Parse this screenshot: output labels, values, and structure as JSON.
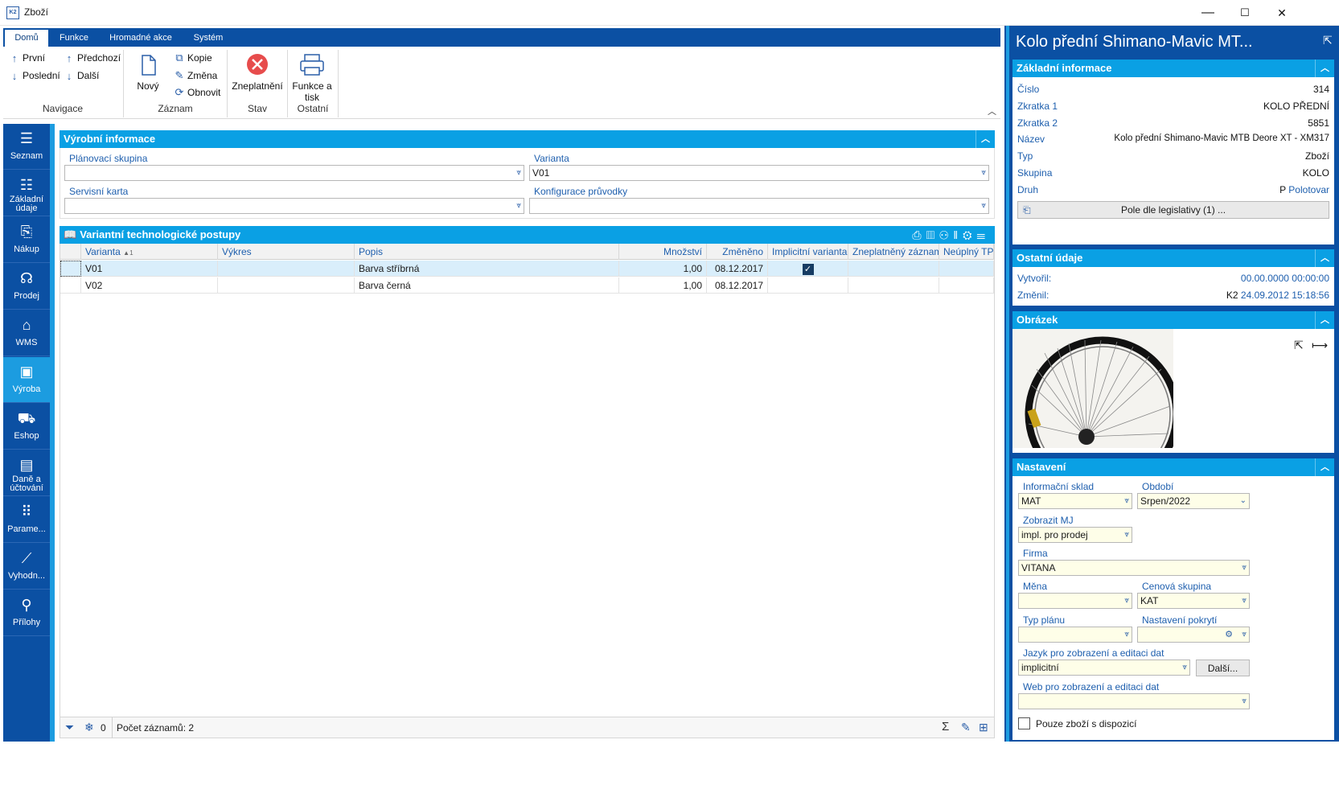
{
  "window": {
    "logo": "K2",
    "title": "Zboží",
    "minimize": "—",
    "maximize": "☐",
    "close": "✕"
  },
  "ribbon": {
    "tabs": [
      "Domů",
      "Funkce",
      "Hromadné akce",
      "Systém"
    ],
    "navigace": {
      "first": "První",
      "last": "Poslední",
      "prev": "Předchozí",
      "next": "Další",
      "label": "Navigace"
    },
    "zaznam": {
      "new": "Nový",
      "copy": "Kopie",
      "change": "Změna",
      "refresh": "Obnovit",
      "label": "Záznam"
    },
    "stav": {
      "invalidate": "Zneplatnění",
      "label": "Stav"
    },
    "ostatni": {
      "functions_line1": "Funkce a",
      "functions_line2": "tisk",
      "label": "Ostatní"
    }
  },
  "nav": [
    {
      "label": "Seznam",
      "icon": "list-icon"
    },
    {
      "label": "Základní údaje",
      "icon": "details-icon"
    },
    {
      "label": "Nákup",
      "icon": "purchase-icon"
    },
    {
      "label": "Prodej",
      "icon": "sale-icon"
    },
    {
      "label": "WMS",
      "icon": "warehouse-icon"
    },
    {
      "label": "Výroba",
      "icon": "production-icon"
    },
    {
      "label": "Eshop",
      "icon": "cart-icon"
    },
    {
      "label": "Daně a účtování",
      "icon": "tax-icon"
    },
    {
      "label": "Parame...",
      "icon": "grid-icon"
    },
    {
      "label": "Vyhodn...",
      "icon": "analytics-icon"
    },
    {
      "label": "Přílohy",
      "icon": "paperclip-icon"
    }
  ],
  "production_info": {
    "title": "Výrobní informace",
    "planning_group_label": "Plánovací skupina",
    "planning_group_value": "",
    "variant_label": "Varianta",
    "variant_value": "V01",
    "service_card_label": "Servisní karta",
    "service_card_value": "",
    "config_label": "Konfigurace průvodky",
    "config_value": ""
  },
  "variants_grid": {
    "title": "Variantní technologické postupy",
    "columns": [
      "Varianta",
      "Výkres",
      "Popis",
      "Množství",
      "Změněno",
      "Implicitní varianta",
      "Zneplatněný záznam",
      "Neúplný TP"
    ],
    "sort_indicator": "▲1",
    "rows": [
      {
        "varianta": "V01",
        "vykres": "",
        "popis": "Barva stříbrná",
        "mnozstvi": "1,00",
        "zmeneno": "08.12.2017",
        "implicitni": true
      },
      {
        "varianta": "V02",
        "vykres": "",
        "popis": "Barva černá",
        "mnozstvi": "1,00",
        "zmeneno": "08.12.2017",
        "implicitni": false
      }
    ],
    "status_count_value": "0",
    "status_records": "Počet záznamů: 2"
  },
  "right_panel": {
    "title": "Kolo přední Shimano-Mavic MT...",
    "basic": {
      "title": "Základní informace",
      "cislo_label": "Číslo",
      "cislo": "314",
      "zkratka1_label": "Zkratka 1",
      "zkratka1": "KOLO PŘEDNÍ",
      "zkratka2_label": "Zkratka 2",
      "zkratka2": "5851",
      "nazev_label": "Název",
      "nazev": "Kolo přední Shimano-Mavic MTB Deore XT - XM317",
      "typ_label": "Typ",
      "typ": "Zboží",
      "skupina_label": "Skupina",
      "skupina": "KOLO",
      "druh_label": "Druh",
      "druh_code": "P",
      "druh": "Polotovar",
      "legislation_button": "Pole dle legislativy (1) ..."
    },
    "other": {
      "title": "Ostatní údaje",
      "created_label": "Vytvořil:",
      "created": "00.00.0000 00:00:00",
      "changed_label": "Změnil:",
      "changed_user": "K2",
      "changed": "24.09.2012 15:18:56"
    },
    "image": {
      "title": "Obrázek"
    },
    "settings": {
      "title": "Nastavení",
      "info_store_label": "Informační sklad",
      "info_store": "MAT",
      "period_label": "Období",
      "period": "Srpen/2022",
      "show_mj_label": "Zobrazit MJ",
      "show_mj": "impl. pro prodej",
      "company_label": "Firma",
      "company": "VITANA",
      "currency_label": "Měna",
      "currency": "",
      "price_group_label": "Cenová skupina",
      "price_group": "KAT",
      "plan_type_label": "Typ plánu",
      "plan_type": "",
      "coverage_label": "Nastavení pokrytí",
      "coverage": "",
      "language_label": "Jazyk pro zobrazení a editaci dat",
      "language": "implicitní",
      "more_button": "Další...",
      "web_label": "Web pro zobrazení a editaci dat",
      "web": "",
      "available_only": "Pouze zboží s dispozicí"
    }
  }
}
